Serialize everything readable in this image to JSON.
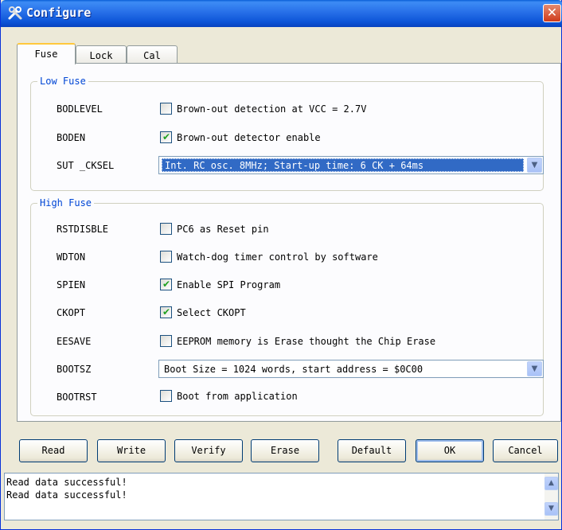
{
  "window": {
    "title": "Configure",
    "close_glyph": "✕"
  },
  "tabs": [
    {
      "label": "Fuse",
      "active": true
    },
    {
      "label": "Lock",
      "active": false
    },
    {
      "label": "Cal",
      "active": false
    }
  ],
  "low_fuse": {
    "legend": "Low Fuse",
    "bodlevel": {
      "label": "BODLEVEL",
      "checked": false,
      "text": "Brown-out detection at VCC = 2.7V"
    },
    "boden": {
      "label": "BODEN",
      "checked": true,
      "text": "Brown-out detector enable"
    },
    "sut_cksel": {
      "label": "SUT _CKSEL",
      "value": "Int. RC osc. 8MHz; Start-up time: 6 CK + 64ms"
    }
  },
  "high_fuse": {
    "legend": "High Fuse",
    "rstdisble": {
      "label": "RSTDISBLE",
      "checked": false,
      "text": "PC6 as Reset pin"
    },
    "wdton": {
      "label": "WDTON",
      "checked": false,
      "text": "Watch-dog timer control by software"
    },
    "spien": {
      "label": "SPIEN",
      "checked": true,
      "text": "Enable SPI Program"
    },
    "ckopt": {
      "label": "CKOPT",
      "checked": true,
      "text": "Select CKOPT"
    },
    "eesave": {
      "label": "EESAVE",
      "checked": false,
      "text": "EEPROM memory is Erase thought the Chip Erase"
    },
    "bootsz": {
      "label": "BOOTSZ",
      "value": "Boot Size = 1024 words, start address = $0C00"
    },
    "bootrst": {
      "label": "BOOTRST",
      "checked": false,
      "text": "Boot from application"
    }
  },
  "buttons": {
    "read": "Read",
    "write": "Write",
    "verify": "Verify",
    "erase": "Erase",
    "default": "Default",
    "ok": "OK",
    "cancel": "Cancel"
  },
  "log": {
    "lines": [
      "Read data successful!",
      "Read data successful!"
    ]
  },
  "icons": {
    "checkmark": "✔",
    "dropdown": "▼",
    "scroll_up": "▲",
    "scroll_down": "▼"
  },
  "colors": {
    "titlebar": "#2a73ea",
    "legend_text": "#0046d5",
    "checkmark": "#21a121",
    "selection": "#316ac5"
  }
}
